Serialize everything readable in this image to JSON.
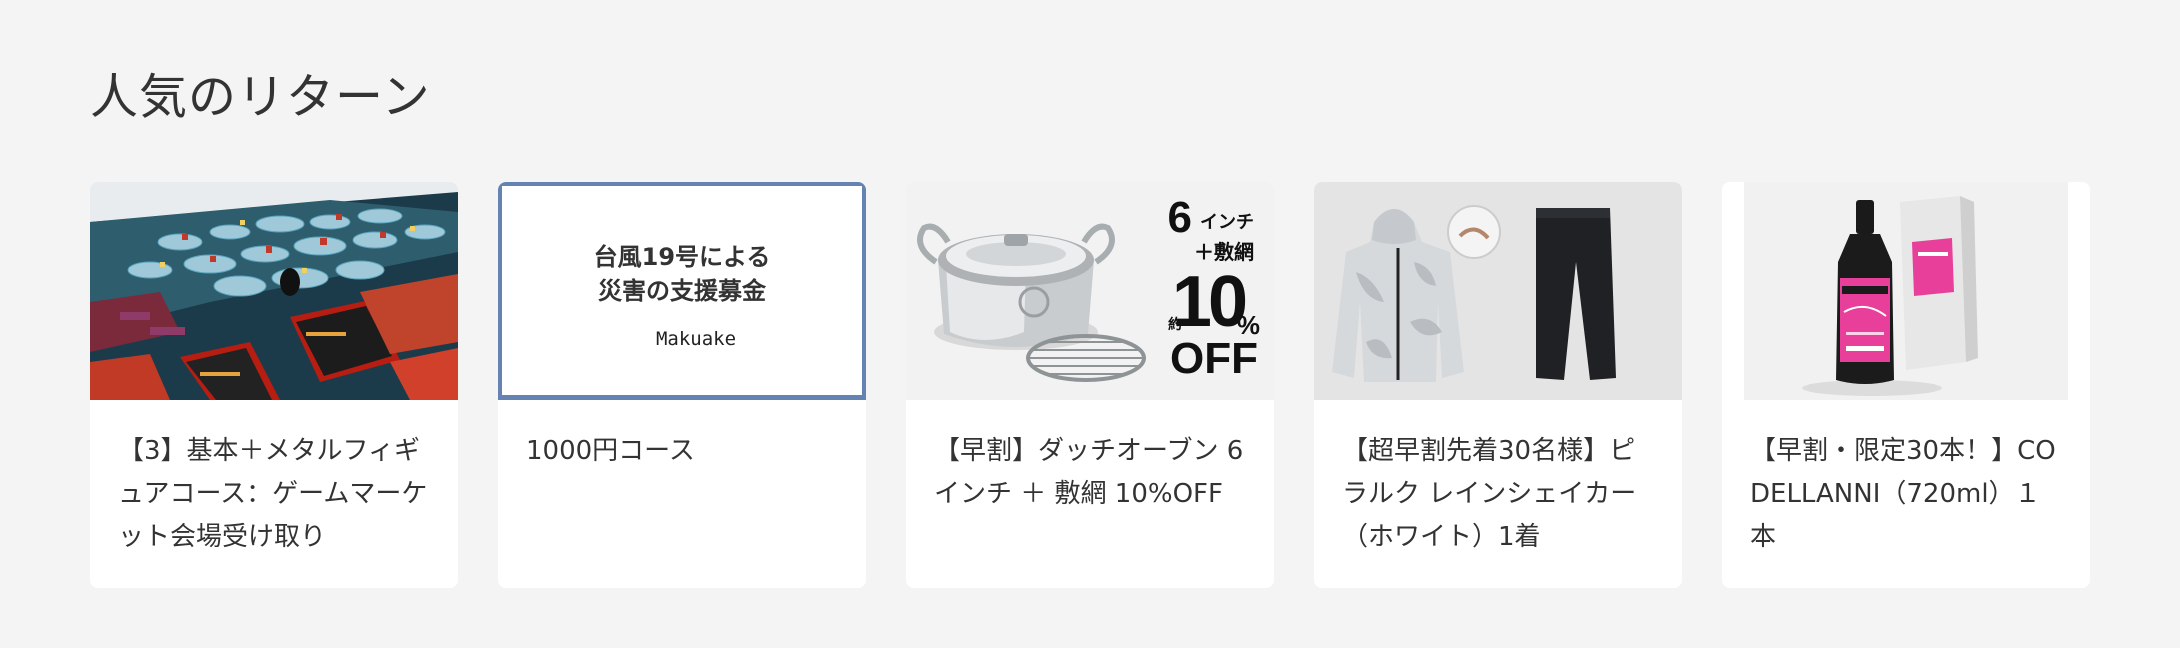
{
  "section": {
    "title": "人気のリターン"
  },
  "cards": [
    {
      "title": "【3】基本＋メタルフィギュアコース：ゲームマーケット会場受け取り",
      "image": "board-game-photo"
    },
    {
      "title": "1000円コース",
      "image": "disaster-support-banner",
      "image_text_line1": "台風19号による",
      "image_text_line2": "災害の支援募金",
      "image_brand": "Makuake"
    },
    {
      "title": "【早割】ダッチオーブン 6インチ ＋ 敷網 10%OFF",
      "image": "dutch-oven-photo",
      "promo_6": "6",
      "promo_inch": "インチ",
      "promo_net": "＋敷網",
      "promo_approx": "約",
      "promo_10": "10",
      "promo_pct": "%",
      "promo_off": "OFF"
    },
    {
      "title": "【超早割先着30名様】ピラルク レインシェイカー（ホワイト）1着",
      "image": "rain-jacket-photo"
    },
    {
      "title": "【早割・限定30本！】CO DELLANNI（720ml）１本",
      "image": "liquor-bottle-photo"
    }
  ],
  "colors": {
    "background": "#f4f4f4",
    "card": "#ffffff",
    "text": "#333333",
    "selected_border": "#6483b3",
    "bottle_pink": "#e8409a"
  }
}
